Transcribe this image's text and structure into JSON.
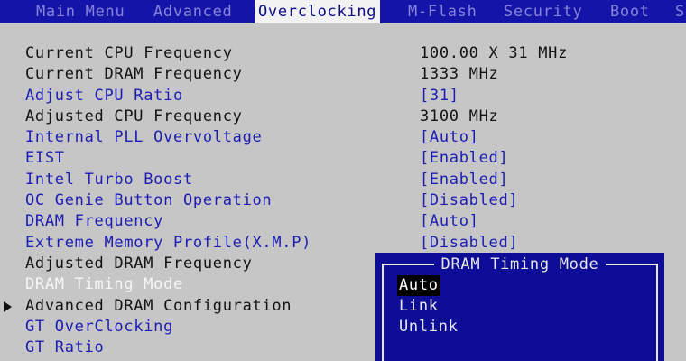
{
  "tabs": [
    {
      "label": "Main Menu",
      "active": false
    },
    {
      "label": "Advanced",
      "active": false
    },
    {
      "label": "Overclocking",
      "active": true
    },
    {
      "label": "M-Flash",
      "active": false
    },
    {
      "label": "Security",
      "active": false
    },
    {
      "label": "Boot",
      "active": false
    },
    {
      "label": "S",
      "active": false
    }
  ],
  "settings": [
    {
      "label": "Current CPU Frequency",
      "value": "100.00 X 31 MHz",
      "kind": "static"
    },
    {
      "label": "Current DRAM Frequency",
      "value": "1333 MHz",
      "kind": "static"
    },
    {
      "label": "Adjust CPU Ratio",
      "value": "[31]",
      "kind": "config"
    },
    {
      "label": "Adjusted CPU Frequency",
      "value": "3100 MHz",
      "kind": "static"
    },
    {
      "label": "Internal PLL Overvoltage",
      "value": "[Auto]",
      "kind": "config"
    },
    {
      "label": "EIST",
      "value": "[Enabled]",
      "kind": "config"
    },
    {
      "label": "Intel Turbo Boost",
      "value": "[Enabled]",
      "kind": "config"
    },
    {
      "label": "OC Genie Button Operation",
      "value": "[Disabled]",
      "kind": "config"
    },
    {
      "label": "DRAM Frequency",
      "value": "[Auto]",
      "kind": "config"
    },
    {
      "label": "Extreme Memory Profile(X.M.P)",
      "value": "[Disabled]",
      "kind": "config"
    },
    {
      "label": "Adjusted DRAM Frequency",
      "value": "",
      "kind": "static"
    },
    {
      "label": "DRAM Timing Mode",
      "value": "",
      "kind": "selected"
    },
    {
      "label": "Advanced DRAM Configuration",
      "value": "",
      "kind": "submenu"
    },
    {
      "label": "GT OverClocking",
      "value": "",
      "kind": "config"
    },
    {
      "label": "GT Ratio",
      "value": "",
      "kind": "config"
    }
  ],
  "popup": {
    "title": "DRAM Timing Mode",
    "options": [
      "Auto",
      "Link",
      "Unlink"
    ],
    "selected": "Auto"
  },
  "colors": {
    "top_bar": "#1414a8",
    "background": "#c6c6c6",
    "config_text": "#1c1cb4",
    "static_text": "#121212",
    "selected_text": "#f6f6f6",
    "popup_bg": "#0d0d98"
  },
  "icons": {
    "submenu": "right-triangle-icon"
  }
}
